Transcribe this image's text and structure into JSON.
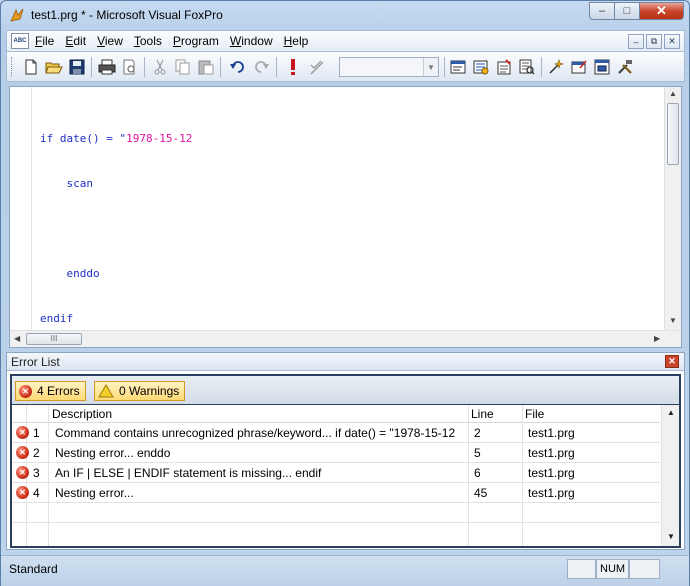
{
  "window": {
    "title": "test1.prg * - Microsoft Visual FoxPro",
    "minimize_glyph": "–",
    "maximize_glyph": "□",
    "close_glyph": "✕"
  },
  "menubar": {
    "app_icon_text": "ABC",
    "items": [
      {
        "accel": "F",
        "rest": "ile"
      },
      {
        "accel": "E",
        "rest": "dit"
      },
      {
        "accel": "V",
        "rest": "iew"
      },
      {
        "accel": "T",
        "rest": "ools"
      },
      {
        "accel": "P",
        "rest": "rogram"
      },
      {
        "accel": "W",
        "rest": "indow"
      },
      {
        "accel": "H",
        "rest": "elp"
      }
    ],
    "mdi": {
      "minimize": "–",
      "restore": "⧉",
      "close": "✕"
    }
  },
  "toolbar": {
    "buttons": [
      "new-icon",
      "open-icon",
      "save-icon",
      "print-icon",
      "print-preview-icon",
      "cut-icon",
      "copy-icon",
      "paste-icon",
      "undo-icon",
      "redo-icon",
      "run-icon",
      "modify-form-icon",
      "command-window-icon",
      "data-session-icon",
      "properties-icon",
      "code-references-icon",
      "form-wizard-icon",
      "report-designer-icon",
      "class-browser-icon",
      "options-icon"
    ],
    "combo_value": "",
    "combo_arrow": "▼"
  },
  "editor": {
    "lines": [
      {
        "text": "if date() = \"",
        "str": "1978-15-12"
      },
      {
        "text": "    scan",
        "str": ""
      },
      {
        "text": "",
        "str": ""
      },
      {
        "text": "    enddo",
        "str": ""
      },
      {
        "text": "endif",
        "str": ""
      }
    ],
    "scroll_up": "▲",
    "scroll_down": "▼",
    "scroll_left": "◀",
    "scroll_right": "▶",
    "hthumb_grip": "III"
  },
  "error_list": {
    "title": "Error List",
    "close_glyph": "✕",
    "errors_tab": "4 Errors",
    "warnings_tab": "0 Warnings",
    "columns": {
      "description": "Description",
      "line": "Line",
      "file": "File"
    },
    "rows": [
      {
        "num": "1",
        "description": "Command contains unrecognized phrase/keyword... if date() = \"1978-15-12",
        "line": "2",
        "file": "test1.prg"
      },
      {
        "num": "2",
        "description": "Nesting error... enddo",
        "line": "5",
        "file": "test1.prg"
      },
      {
        "num": "3",
        "description": "An IF | ELSE | ENDIF statement is missing... endif",
        "line": "6",
        "file": "test1.prg"
      },
      {
        "num": "4",
        "description": "Nesting error...",
        "line": "45",
        "file": "test1.prg"
      }
    ],
    "error_icon_glyph": "✕",
    "warning_icon_glyph": "!"
  },
  "statusbar": {
    "text": "Standard",
    "num": "NUM"
  }
}
